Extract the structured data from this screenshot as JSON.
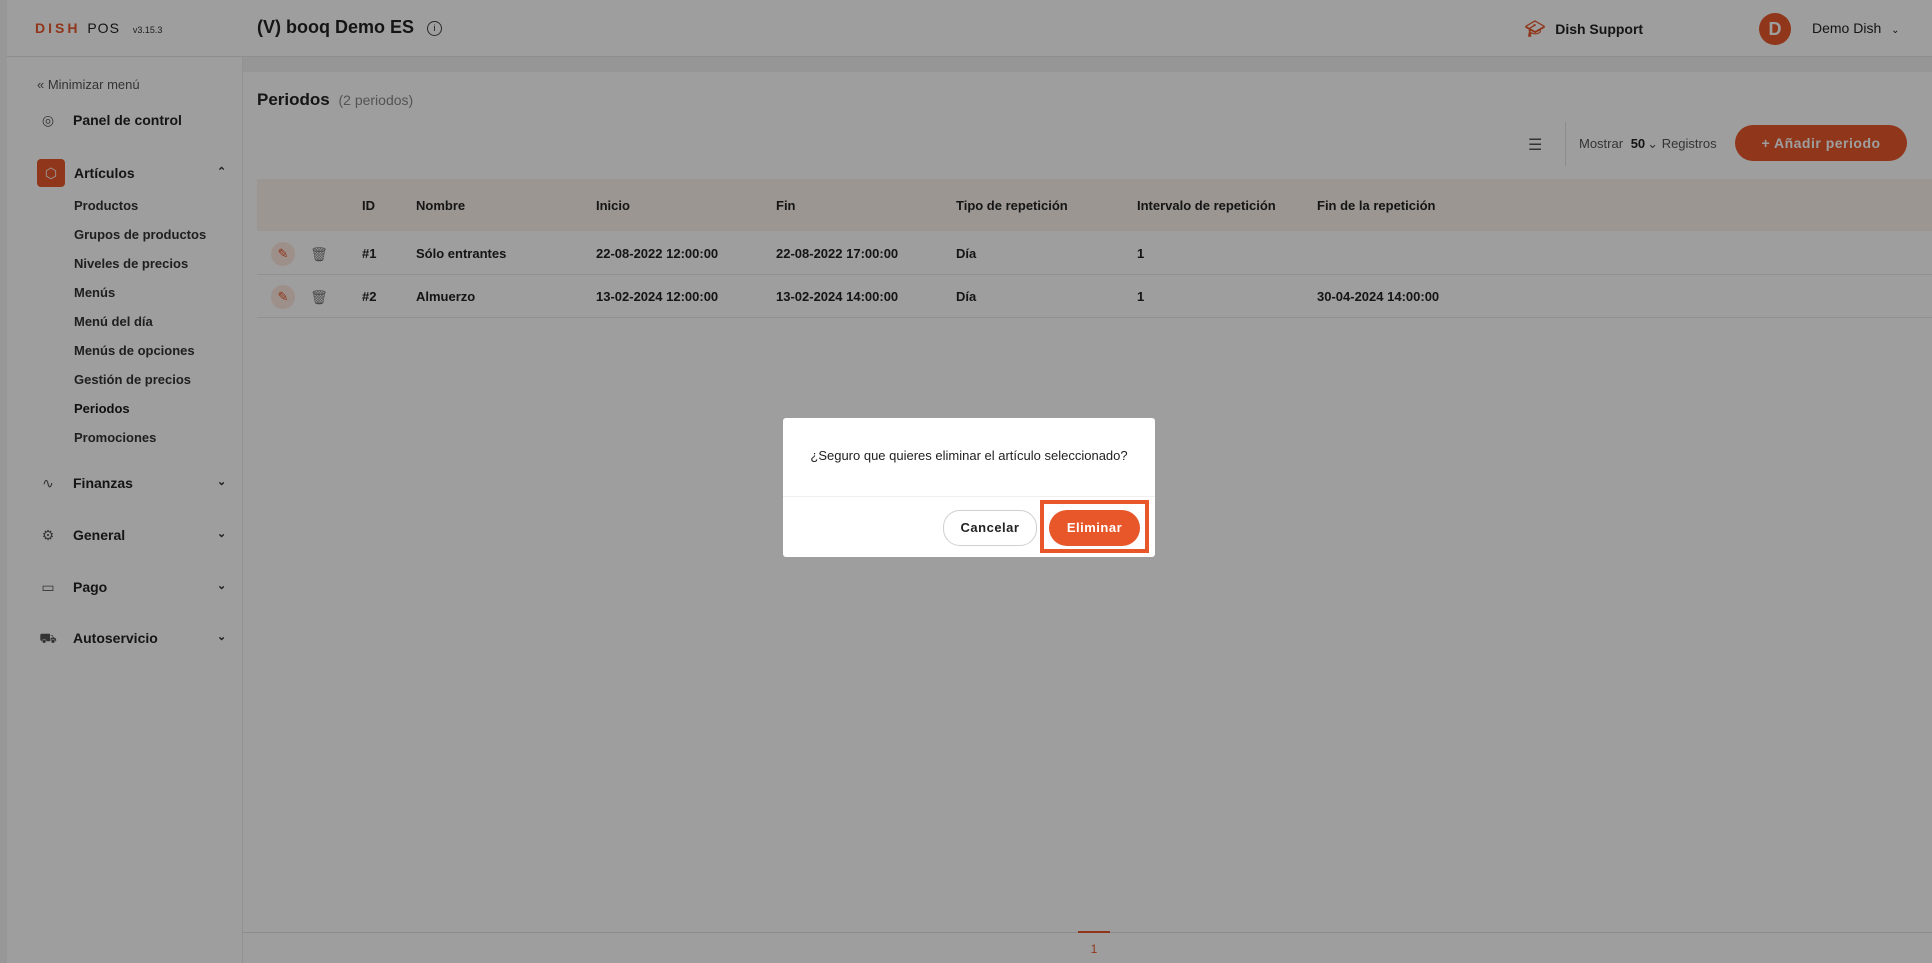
{
  "topbar": {
    "brand_dish": "DISH",
    "brand_pos": "POS",
    "version": "v3.15.3",
    "venue": "(V) booq Demo ES",
    "support": "Dish Support",
    "avatar_letter": "D",
    "user": "Demo Dish"
  },
  "sidebar": {
    "minimize": "« Minimizar menú",
    "panel": "Panel de control",
    "articulos": "Artículos",
    "sub_items": [
      "Productos",
      "Grupos de productos",
      "Niveles de precios",
      "Menús",
      "Menú del día",
      "Menús de opciones",
      "Gestión de precios",
      "Periodos",
      "Promociones"
    ],
    "finanzas": "Finanzas",
    "general": "General",
    "pago": "Pago",
    "autoservicio": "Autoservicio"
  },
  "main": {
    "title": "Periodos",
    "count": "(2 periodos)",
    "show_label": "Mostrar",
    "show_value": "50",
    "records_label": "Registros",
    "add_button": "+ Añadir periodo",
    "columns": [
      "ID",
      "Nombre",
      "Inicio",
      "Fin",
      "Tipo de repetición",
      "Intervalo de repetición",
      "Fin de la repetición"
    ],
    "rows": [
      [
        "#1",
        "Sólo entrantes",
        "22-08-2022 12:00:00",
        "22-08-2022 17:00:00",
        "Día",
        "1",
        ""
      ],
      [
        "#2",
        "Almuerzo",
        "13-02-2024 12:00:00",
        "13-02-2024 14:00:00",
        "Día",
        "1",
        "30-04-2024 14:00:00"
      ]
    ],
    "page": "1"
  },
  "dialog": {
    "question": "¿Seguro que quieres eliminar el artículo seleccionado?",
    "cancel": "Cancelar",
    "confirm": "Eliminar"
  },
  "colors": {
    "accent": "#e8572a",
    "header_bg": "#faf2ea"
  }
}
